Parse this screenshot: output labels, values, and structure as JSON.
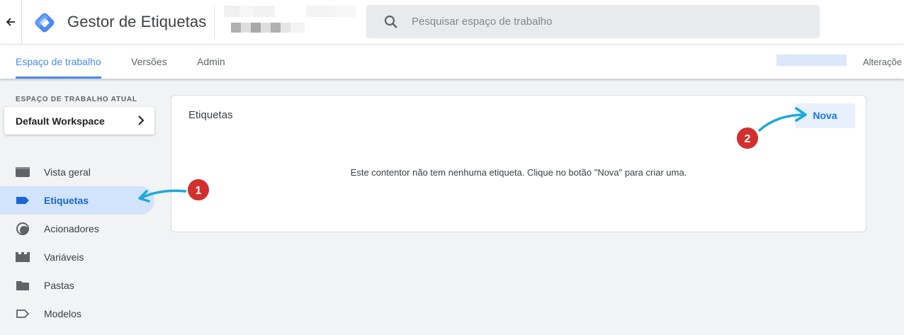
{
  "header": {
    "app_title": "Gestor de Etiquetas",
    "search_placeholder": "Pesquisar espaço de trabalho"
  },
  "tabs": [
    {
      "label": "Espaço de trabalho",
      "active": true
    },
    {
      "label": "Versões",
      "active": false
    },
    {
      "label": "Admin",
      "active": false
    }
  ],
  "tabbar_right": {
    "changes_label": "Alteraçõe"
  },
  "sidebar": {
    "workspace_heading": "ESPAÇO DE TRABALHO ATUAL",
    "workspace_name": "Default Workspace",
    "items": [
      {
        "label": "Vista geral",
        "icon": "overview-icon"
      },
      {
        "label": "Etiquetas",
        "icon": "tag-icon",
        "active": true
      },
      {
        "label": "Acionadores",
        "icon": "trigger-icon"
      },
      {
        "label": "Variáveis",
        "icon": "variables-icon"
      },
      {
        "label": "Pastas",
        "icon": "folder-icon"
      },
      {
        "label": "Modelos",
        "icon": "template-icon"
      }
    ]
  },
  "main": {
    "card_title": "Etiquetas",
    "new_button": "Nova",
    "empty_message": "Este contentor não tem nenhuma etiqueta. Clique no botão \"Nova\" para criar uma."
  },
  "annotations": [
    {
      "number": "1"
    },
    {
      "number": "2"
    }
  ],
  "colors": {
    "accent": "#4a8af4",
    "badge": "#d32f2f",
    "arrow": "#1fa8d8",
    "active_nav_bg": "#d2e3fc"
  }
}
